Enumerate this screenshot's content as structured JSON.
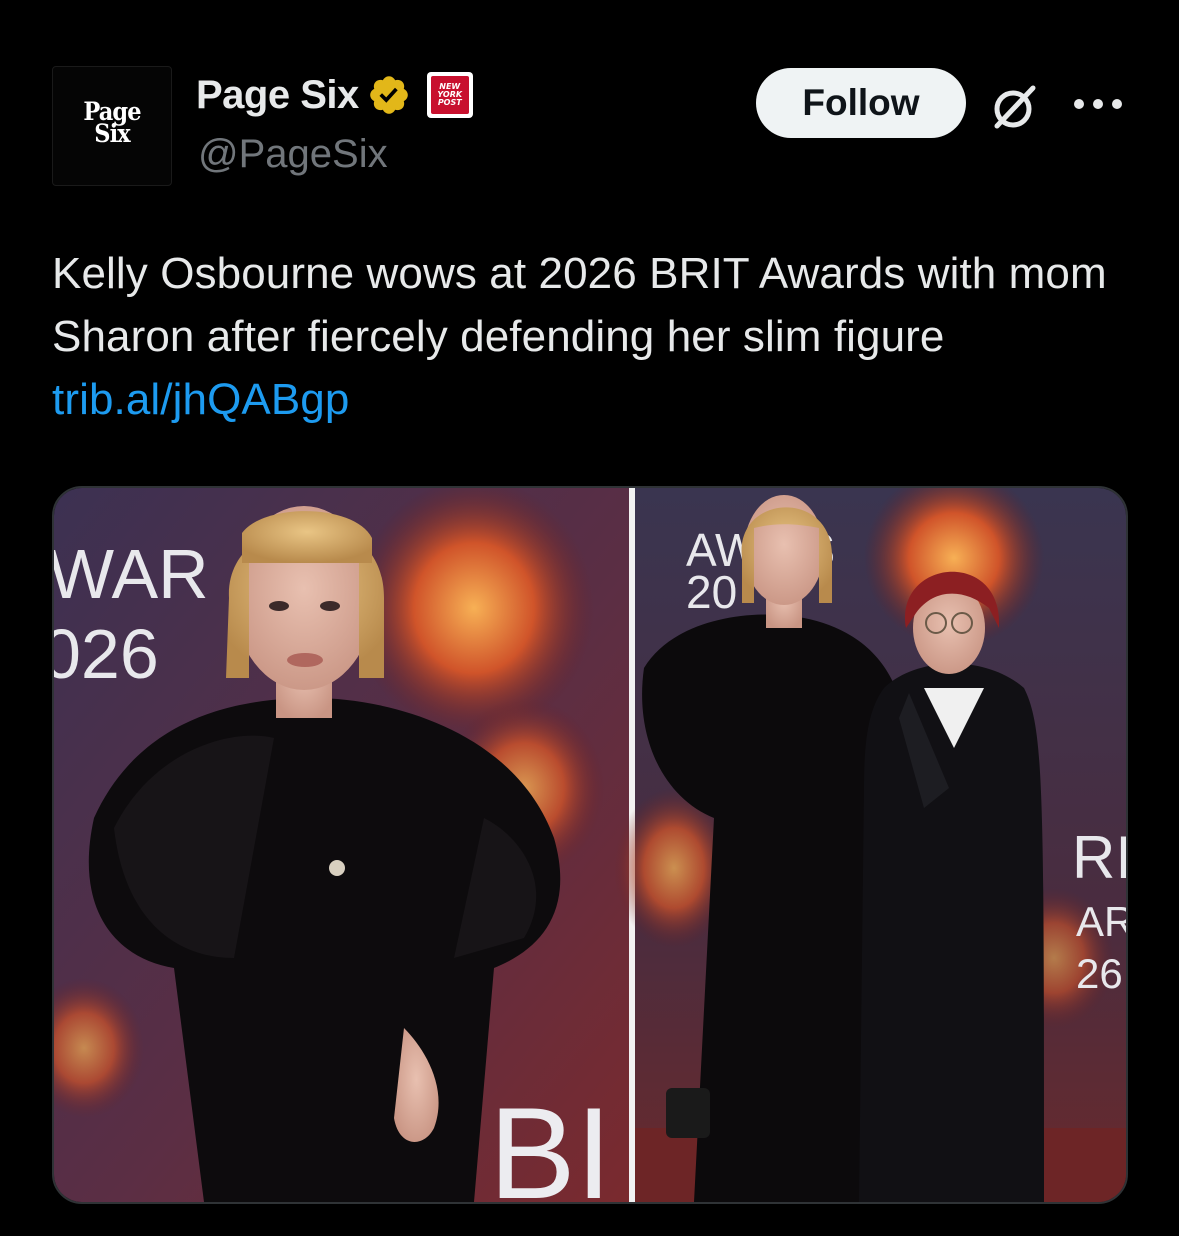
{
  "account": {
    "avatar_line1": "Page",
    "avatar_line2": "Six",
    "display_name": "Page Six",
    "handle": "@PageSix",
    "verified_icon": "verified-badge-gold",
    "affiliate_badge": {
      "line1": "NEW",
      "line2": "YORK",
      "line3": "POST"
    }
  },
  "actions": {
    "follow_label": "Follow",
    "grok_icon": "grok-icon",
    "more_icon": "more-horizontal-icon"
  },
  "tweet": {
    "text": "Kelly Osbourne wows at 2026 BRIT Awards with mom Sharon after fiercely defending her slim figure ",
    "link": "trib.al/jhQABgp"
  },
  "media": {
    "left_backdrop_text": {
      "line1": "WAR",
      "line2": "026"
    },
    "right_backdrop_text": {
      "line1": "AW   DS",
      "line2": "20"
    },
    "side_text": {
      "line1": "RI",
      "line2": "AR",
      "line3": "26"
    },
    "bottom_text": "BI"
  },
  "colors": {
    "background": "#000000",
    "text": "#e7e9ea",
    "secondary": "#71767b",
    "link": "#1d9bf0",
    "verified_gold": "#e2b719",
    "follow_bg": "#eff3f4"
  }
}
